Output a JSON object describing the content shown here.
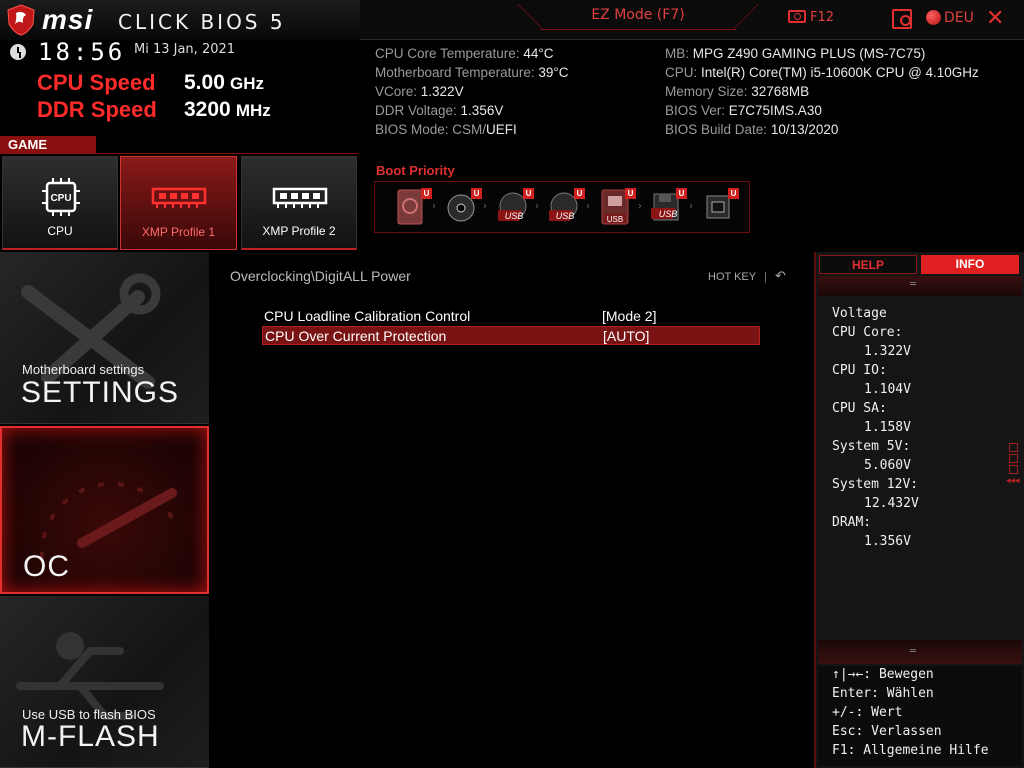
{
  "header": {
    "brand": "msi",
    "product": "click bios 5",
    "ez_mode": "EZ Mode (F7)",
    "screenshot": "F12",
    "language": "DEU"
  },
  "clock": {
    "time": "18:56",
    "date": "Mi  13 Jan, 2021"
  },
  "speeds": {
    "cpu_label": "CPU Speed",
    "cpu_value": "5.00",
    "cpu_unit": "GHz",
    "ddr_label": "DDR Speed",
    "ddr_value": "3200",
    "ddr_unit": "MHz"
  },
  "sysinfo": {
    "left": [
      {
        "label": "CPU Core Temperature: ",
        "value": "44°C"
      },
      {
        "label": "Motherboard Temperature: ",
        "value": "39°C"
      },
      {
        "label": "VCore: ",
        "value": "1.322V"
      },
      {
        "label": "DDR Voltage: ",
        "value": "1.356V"
      },
      {
        "label": "BIOS Mode: CSM/",
        "value": "UEFI"
      }
    ],
    "right": [
      {
        "label": "MB: ",
        "value": "MPG Z490 GAMING PLUS (MS-7C75)"
      },
      {
        "label": "CPU: ",
        "value": "Intel(R) Core(TM) i5-10600K CPU @ 4.10GHz"
      },
      {
        "label": "Memory Size: ",
        "value": "32768MB"
      },
      {
        "label": "BIOS Ver: ",
        "value": "E7C75IMS.A30"
      },
      {
        "label": "BIOS Build Date: ",
        "value": "10/13/2020"
      }
    ]
  },
  "game_boost": {
    "label": "GAME BOOST",
    "tiles": [
      {
        "label": "CPU",
        "icon_text": "CPU"
      },
      {
        "label": "XMP Profile 1"
      },
      {
        "label": "XMP Profile 2"
      }
    ]
  },
  "boot_priority": {
    "label": "Boot Priority",
    "badge": "U",
    "usb_text": "USB",
    "devices": [
      "hdd-icon",
      "optical-disc-icon",
      "usb-disc-icon",
      "usb-disc-icon",
      "usb-key-icon",
      "usb-floppy-icon",
      "network-icon"
    ]
  },
  "menu": {
    "settings": {
      "sub": "Motherboard settings",
      "title": "SETTINGS"
    },
    "oc": {
      "title": "OC"
    },
    "mflash": {
      "sub": "Use USB to flash BIOS",
      "title": "M-FLASH"
    }
  },
  "main": {
    "breadcrumb": "Overclocking\\DigitALL Power",
    "hotkey": "HOT KEY",
    "rows": [
      {
        "name": "CPU Loadline Calibration Control",
        "value": "[Mode 2]"
      },
      {
        "name": "CPU Over Current Protection",
        "value": "[AUTO]"
      }
    ]
  },
  "right_panel": {
    "tabs": {
      "help": "HELP",
      "info": "INFO"
    },
    "title": "Voltage",
    "voltages": [
      {
        "label": "CPU Core:",
        "value": "1.322V"
      },
      {
        "label": "CPU IO:",
        "value": "1.104V"
      },
      {
        "label": "CPU SA:",
        "value": "1.158V"
      },
      {
        "label": "System 5V:",
        "value": "5.060V"
      },
      {
        "label": "System 12V:",
        "value": "12.432V"
      },
      {
        "label": "DRAM:",
        "value": "1.356V"
      }
    ],
    "help": [
      "↑|→←: Bewegen",
      "Enter: Wählen",
      "+/-: Wert",
      "Esc: Verlassen",
      "F1: Allgemeine Hilfe"
    ]
  },
  "colors": {
    "accent": "#e02020",
    "dark_red": "#7a1414",
    "bg": "#000000"
  }
}
